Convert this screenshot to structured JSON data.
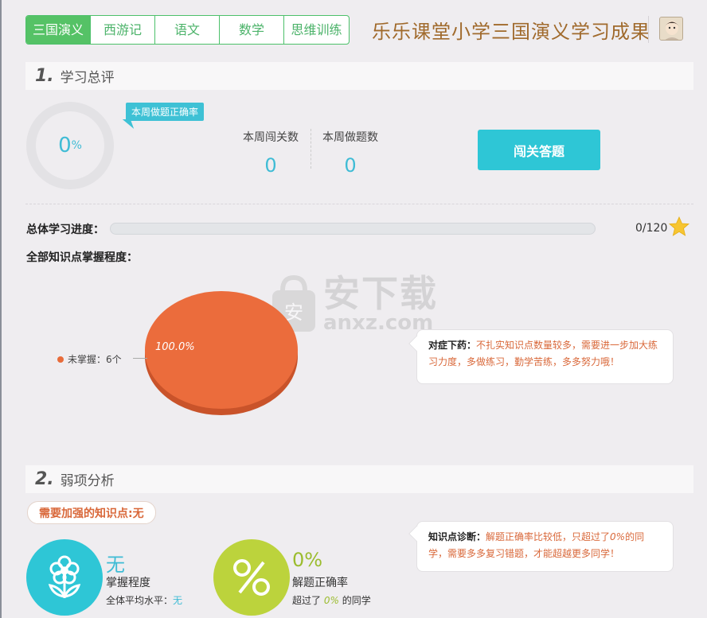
{
  "tabs": [
    {
      "label": "三国演义",
      "active": true
    },
    {
      "label": "西游记",
      "active": false
    },
    {
      "label": "语文",
      "active": false
    },
    {
      "label": "数学",
      "active": false
    },
    {
      "label": "思维训练",
      "active": false
    }
  ],
  "app_title": "乐乐课堂小学三国演义学习成果",
  "section1": {
    "num": "1.",
    "label": "学习总评"
  },
  "accuracy": {
    "value": "0",
    "unit": "%",
    "tip": "本周做题正确率"
  },
  "stats": [
    {
      "label": "本周闯关数",
      "value": "0"
    },
    {
      "label": "本周做题数",
      "value": "0"
    }
  ],
  "primary_button": "闯关答题",
  "progress": {
    "label": "总体学习进度：",
    "count": "0/120",
    "fraction": 0
  },
  "mastery": {
    "label": "全部知识点掌握程度：",
    "pie_label": "100.0%",
    "legend": "未掌握：6个"
  },
  "watermark": {
    "cn": "安下载",
    "en": "anxz.com",
    "badge": "安"
  },
  "advice_card": {
    "title": "对症下药：",
    "text": "不扎实知识点数量较多，需要进一步加大练习力度，多做练习，勤学苦练，多多努力哦！"
  },
  "section2": {
    "num": "2.",
    "label": "弱项分析"
  },
  "weak_points": "需要加强的知识点:无",
  "diagnosis_card": {
    "title": "知识点诊断：",
    "text_a": "解题正确率比较低，只超过了",
    "pct": "0%",
    "text_b": "的同学，需要多多复习错题，才能超越更多同学！"
  },
  "metric_mastery": {
    "value": "无",
    "label": "掌握程度",
    "sub_prefix": "全体平均水平：",
    "sub_value": "无"
  },
  "metric_accuracy": {
    "value": "0%",
    "label": "解题正确率",
    "sub_prefix": "超过了",
    "sub_value": "0%",
    "sub_suffix": "的同学"
  },
  "colors": {
    "tab_green": "#55c266",
    "accent_cyan": "#2ec6d6",
    "pie_orange": "#e86c3a",
    "mastery_circle": "#2ec6d6",
    "accuracy_circle": "#bcd33c",
    "star": "#f7c531"
  },
  "icons": [
    "avatar-icon",
    "star-icon",
    "flower-icon",
    "percent-icon",
    "shield-watermark-icon"
  ]
}
